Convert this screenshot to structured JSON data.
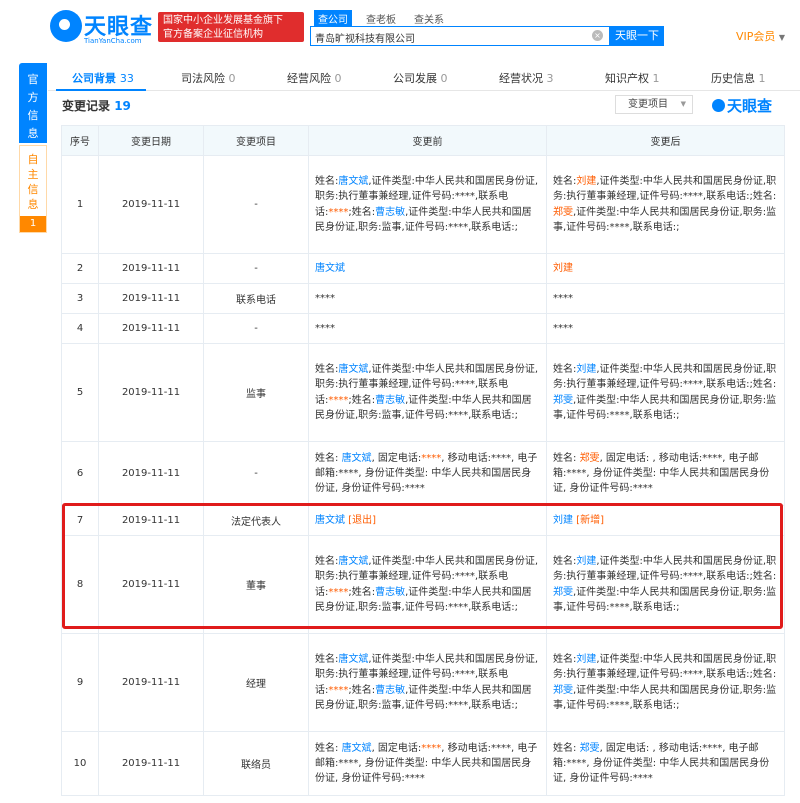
{
  "header": {
    "brand": "天眼查",
    "brand_sub": "TianYanCha.com",
    "badge_line1": "国家中小企业发展基金旗下",
    "badge_line2": "官方备案企业征信机构",
    "search_tabs": [
      "查公司",
      "查老板",
      "查关系"
    ],
    "search_value": "青岛旷视科技有限公司",
    "search_button": "天眼一下",
    "vip": "VIP会员",
    "brand_color": "#0084ff",
    "accent_color": "#e02d2d"
  },
  "side_tabs": {
    "official": "官方信息",
    "self": "自主信息",
    "self_count": "1"
  },
  "nav_tabs": [
    {
      "label": "公司背景",
      "count": "33"
    },
    {
      "label": "司法风险",
      "count": "0"
    },
    {
      "label": "经营风险",
      "count": "0"
    },
    {
      "label": "公司发展",
      "count": "0"
    },
    {
      "label": "经营状况",
      "count": "3"
    },
    {
      "label": "知识产权",
      "count": "1"
    },
    {
      "label": "历史信息",
      "count": "1"
    }
  ],
  "section": {
    "title": "变更记录",
    "count": "19",
    "filter_label": "变更项目",
    "watermark": "天眼查"
  },
  "table": {
    "columns": [
      "序号",
      "变更日期",
      "变更项目",
      "变更前",
      "变更后"
    ],
    "rows": [
      {
        "no": "1",
        "date": "2019-11-11",
        "item": "-",
        "before": [
          {
            "t": "姓名:"
          },
          {
            "t": "唐文斌",
            "c": "bl"
          },
          {
            "t": ",证件类型:中华人民共和国居民身份证,职务:执行董事兼经理,证件号码:****,联系电话:"
          },
          {
            "t": "****",
            "c": "rd"
          },
          {
            "t": ";姓名:"
          },
          {
            "t": "曹志敏",
            "c": "bl"
          },
          {
            "t": ",证件类型:中华人民共和国居民身份证,职务:监事,证件号码:****,联系电话:;"
          }
        ],
        "after": [
          {
            "t": "姓名:"
          },
          {
            "t": "刘建",
            "c": "rd"
          },
          {
            "t": ",证件类型:中华人民共和国居民身份证,职务:执行董事兼经理,证件号码:****,联系电话:;姓名:"
          },
          {
            "t": "郑雯",
            "c": "rd"
          },
          {
            "t": ",证件类型:中华人民共和国居民身份证,职务:监事,证件号码:****,联系电话:;"
          }
        ]
      },
      {
        "no": "2",
        "date": "2019-11-11",
        "item": "-",
        "before": [
          {
            "t": "唐文斌",
            "c": "bl"
          }
        ],
        "after": [
          {
            "t": "刘建",
            "c": "rd"
          }
        ]
      },
      {
        "no": "3",
        "date": "2019-11-11",
        "item": "联系电话",
        "before": [
          {
            "t": "****"
          }
        ],
        "after": [
          {
            "t": "****"
          }
        ]
      },
      {
        "no": "4",
        "date": "2019-11-11",
        "item": "-",
        "before": [
          {
            "t": "****"
          }
        ],
        "after": [
          {
            "t": "****"
          }
        ]
      },
      {
        "no": "5",
        "date": "2019-11-11",
        "item": "监事",
        "before": [
          {
            "t": "姓名:"
          },
          {
            "t": "唐文斌",
            "c": "bl"
          },
          {
            "t": ",证件类型:中华人民共和国居民身份证,职务:执行董事兼经理,证件号码:****,联系电话:"
          },
          {
            "t": "****",
            "c": "rd"
          },
          {
            "t": ";姓名:"
          },
          {
            "t": "曹志敏",
            "c": "bl"
          },
          {
            "t": ",证件类型:中华人民共和国居民身份证,职务:监事,证件号码:****,联系电话:;"
          }
        ],
        "after": [
          {
            "t": "姓名:"
          },
          {
            "t": "刘建",
            "c": "bl"
          },
          {
            "t": ",证件类型:中华人民共和国居民身份证,职务:执行董事兼经理,证件号码:****,联系电话:;姓名:"
          },
          {
            "t": "郑雯",
            "c": "bl"
          },
          {
            "t": ",证件类型:中华人民共和国居民身份证,职务:监事,证件号码:****,联系电话:;"
          }
        ]
      },
      {
        "no": "6",
        "date": "2019-11-11",
        "item": "-",
        "before": [
          {
            "t": "姓名: "
          },
          {
            "t": "唐文斌",
            "c": "bl"
          },
          {
            "t": ", 固定电话:"
          },
          {
            "t": "****",
            "c": "rd"
          },
          {
            "t": ", 移动电话:****, 电子邮箱:****, 身份证件类型: 中华人民共和国居民身份证, 身份证件号码:****"
          }
        ],
        "after": [
          {
            "t": "姓名: "
          },
          {
            "t": "郑雯",
            "c": "rd"
          },
          {
            "t": ", 固定电话: , 移动电话:****, 电子邮箱:****, 身份证件类型: 中华人民共和国居民身份证, 身份证件号码:****"
          }
        ]
      },
      {
        "no": "7",
        "date": "2019-11-11",
        "item": "法定代表人",
        "before": [
          {
            "t": "唐文斌",
            "c": "bl"
          },
          {
            "t": " [退出]",
            "c": "rd"
          }
        ],
        "after": [
          {
            "t": "刘建",
            "c": "bl"
          },
          {
            "t": " [新增]",
            "c": "rd"
          }
        ]
      },
      {
        "no": "8",
        "date": "2019-11-11",
        "item": "董事",
        "before": [
          {
            "t": "姓名:"
          },
          {
            "t": "唐文斌",
            "c": "bl"
          },
          {
            "t": ",证件类型:中华人民共和国居民身份证,职务:执行董事兼经理,证件号码:****,联系电话:"
          },
          {
            "t": "****",
            "c": "rd"
          },
          {
            "t": ";姓名:"
          },
          {
            "t": "曹志敏",
            "c": "bl"
          },
          {
            "t": ",证件类型:中华人民共和国居民身份证,职务:监事,证件号码:****,联系电话:;"
          }
        ],
        "after": [
          {
            "t": "姓名:"
          },
          {
            "t": "刘建",
            "c": "bl"
          },
          {
            "t": ",证件类型:中华人民共和国居民身份证,职务:执行董事兼经理,证件号码:****,联系电话:;姓名:"
          },
          {
            "t": "郑雯",
            "c": "bl"
          },
          {
            "t": ",证件类型:中华人民共和国居民身份证,职务:监事,证件号码:****,联系电话:;"
          }
        ]
      },
      {
        "no": "9",
        "date": "2019-11-11",
        "item": "经理",
        "before": [
          {
            "t": "姓名:"
          },
          {
            "t": "唐文斌",
            "c": "bl"
          },
          {
            "t": ",证件类型:中华人民共和国居民身份证,职务:执行董事兼经理,证件号码:****,联系电话:"
          },
          {
            "t": "****",
            "c": "rd"
          },
          {
            "t": ";姓名:"
          },
          {
            "t": "曹志敏",
            "c": "bl"
          },
          {
            "t": ",证件类型:中华人民共和国居民身份证,职务:监事,证件号码:****,联系电话:;"
          }
        ],
        "after": [
          {
            "t": "姓名:"
          },
          {
            "t": "刘建",
            "c": "bl"
          },
          {
            "t": ",证件类型:中华人民共和国居民身份证,职务:执行董事兼经理,证件号码:****,联系电话:;姓名:"
          },
          {
            "t": "郑雯",
            "c": "bl"
          },
          {
            "t": ",证件类型:中华人民共和国居民身份证,职务:监事,证件号码:****,联系电话:;"
          }
        ]
      },
      {
        "no": "10",
        "date": "2019-11-11",
        "item": "联络员",
        "before": [
          {
            "t": "姓名: "
          },
          {
            "t": "唐文斌",
            "c": "bl"
          },
          {
            "t": ", 固定电话:"
          },
          {
            "t": "****",
            "c": "rd"
          },
          {
            "t": ", 移动电话:****, 电子邮箱:****, 身份证件类型: 中华人民共和国居民身份证, 身份证件号码:****"
          }
        ],
        "after": [
          {
            "t": "姓名: "
          },
          {
            "t": "郑雯",
            "c": "bl"
          },
          {
            "t": ", 固定电话: , 移动电话:****, 电子邮箱:****, 身份证件类型: 中华人民共和国居民身份证, 身份证件号码:****"
          }
        ]
      }
    ]
  }
}
